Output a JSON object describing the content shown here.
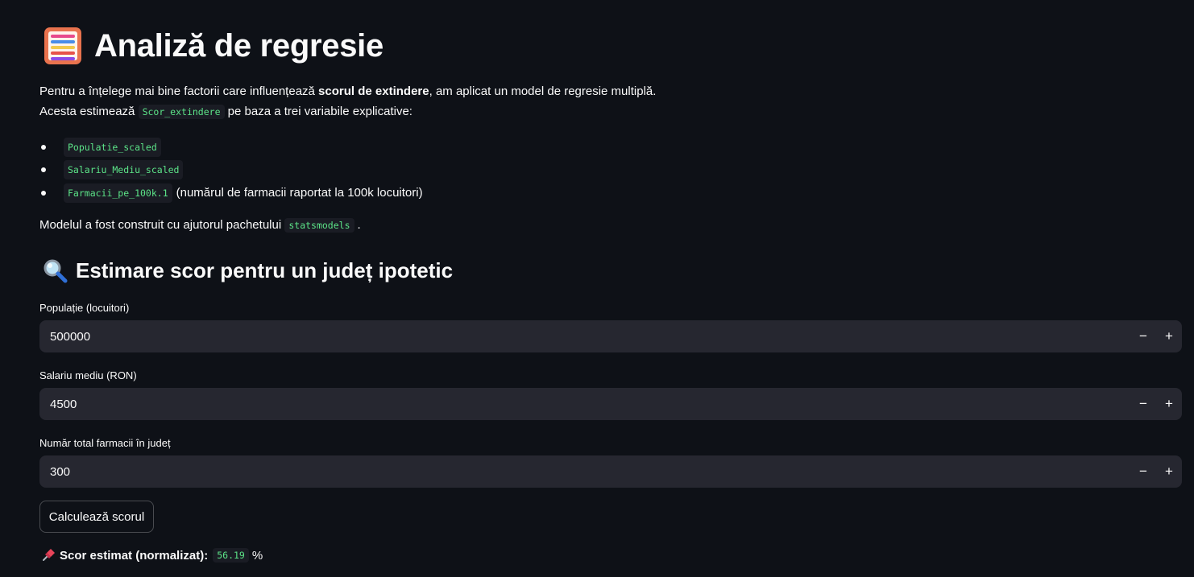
{
  "header": {
    "icon": "abacus-icon",
    "title": "Analiză de regresie"
  },
  "intro": {
    "line1_pre": "Pentru a înțelege mai bine factorii care influențează ",
    "line1_bold": "scorul de extindere",
    "line1_post": ", am aplicat un model de regresie multiplă.",
    "line2_pre": "Acesta estimează ",
    "line2_code": "Scor_extindere",
    "line2_post": " pe baza a trei variabile explicative:"
  },
  "variables": [
    {
      "code": "Populatie_scaled",
      "note": ""
    },
    {
      "code": "Salariu_Mediu_scaled",
      "note": ""
    },
    {
      "code": "Farmacii_pe_100k.1",
      "note": "(numărul de farmacii raportat la 100k locuitori)"
    }
  ],
  "model_note": {
    "pre": "Modelul a fost construit cu ajutorul pachetului ",
    "code": "statsmodels",
    "post": "."
  },
  "section": {
    "icon": "magnifier-icon",
    "title": "Estimare scor pentru un județ ipotetic"
  },
  "inputs": [
    {
      "label": "Populație (locuitori)",
      "value": "500000"
    },
    {
      "label": "Salariu mediu (RON)",
      "value": "4500"
    },
    {
      "label": "Număr total farmacii în județ",
      "value": "300"
    }
  ],
  "stepper": {
    "minus": "−",
    "plus": "+"
  },
  "button": {
    "label": "Calculează scorul"
  },
  "result": {
    "icon": "pushpin-icon",
    "label": "Scor estimat (normalizat):",
    "value": "56.19",
    "unit": "%"
  },
  "colors": {
    "background": "#0e1117",
    "input_bg": "#262730",
    "code_text": "#5ce488",
    "text": "#fafafa"
  }
}
